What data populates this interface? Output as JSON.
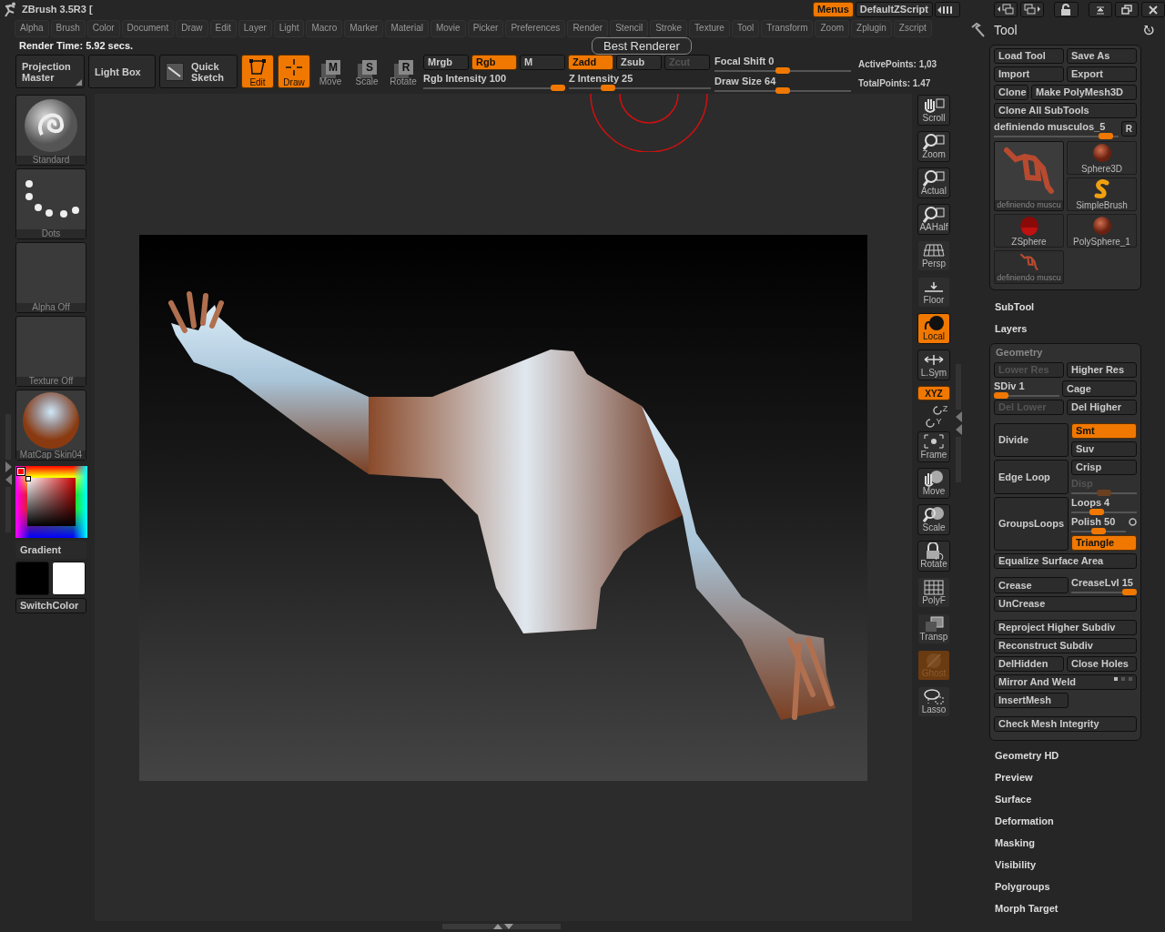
{
  "title": "ZBrush 3.5R3 [",
  "top_buttons": [
    {
      "label": "Menus",
      "selected": true
    },
    {
      "label": "DefaultZScript",
      "selected": false
    }
  ],
  "menus": [
    "Alpha",
    "Brush",
    "Color",
    "Document",
    "Draw",
    "Edit",
    "Layer",
    "Light",
    "Macro",
    "Marker",
    "Material",
    "Movie",
    "Picker",
    "Preferences",
    "Render",
    "Stencil",
    "Stroke",
    "Texture",
    "Tool",
    "Transform",
    "Zoom",
    "Zplugin",
    "Zscript"
  ],
  "render_time": "Render Time: 5.92 secs.",
  "tooltip": "Best Renderer",
  "toolbar": {
    "big_buttons": [
      {
        "kind": "corner",
        "label": "Projection Master"
      },
      {
        "kind": "plain",
        "label": "Light Box"
      },
      {
        "kind": "sketch",
        "label": "Quick Sketch"
      }
    ],
    "transform_modes": [
      {
        "kind": "edit",
        "label": "Edit",
        "selected": true
      },
      {
        "kind": "draw",
        "label": "Draw",
        "selected": true
      },
      {
        "kind": "letter",
        "key": "M",
        "label": "Move",
        "selected": false
      },
      {
        "kind": "letter",
        "key": "S",
        "label": "Scale",
        "selected": false
      },
      {
        "kind": "letter",
        "key": "R",
        "label": "Rotate",
        "selected": false
      }
    ],
    "color_modes": [
      {
        "label": "Mrgb",
        "selected": false
      },
      {
        "label": "Rgb",
        "selected": true
      },
      {
        "label": "M",
        "selected": false
      }
    ],
    "z_modes": [
      {
        "label": "Zadd",
        "selected": true
      },
      {
        "label": "Zsub",
        "selected": false
      },
      {
        "label": "Zcut",
        "selected": false
      }
    ],
    "sliders": [
      {
        "label": "Rgb Intensity 100",
        "level": 1
      },
      {
        "label": "Z Intensity 25",
        "level": 0.25
      },
      {
        "label": "Focal Shift 0",
        "level": 0.5
      },
      {
        "label": "Draw Size 64",
        "level": 0.5
      }
    ],
    "stats": [
      "ActivePoints: 1,03",
      "TotalPoints: 1.47"
    ]
  },
  "left_shelf": {
    "tiles": [
      {
        "kind": "brush",
        "label": "Standard"
      },
      {
        "kind": "dots",
        "label": "Dots"
      },
      {
        "kind": "empty",
        "label": "Alpha  Off"
      },
      {
        "kind": "empty",
        "label": "Texture  Off"
      },
      {
        "kind": "material",
        "label": "MatCap  Skin04"
      }
    ],
    "picker": {
      "color": "#ff0000"
    },
    "gradient": "Gradient",
    "swatches": [
      {
        "color": "#000000"
      },
      {
        "color": "#ffffff"
      }
    ],
    "switch": "SwitchColor"
  },
  "right_shelf": [
    {
      "kind": "scroll",
      "label": "Scroll",
      "on": false
    },
    {
      "kind": "zoom",
      "label": "Zoom",
      "on": false
    },
    {
      "kind": "actual",
      "label": "Actual",
      "on": false
    },
    {
      "kind": "aahalf",
      "label": "AAHalf",
      "on": false
    },
    {
      "kind": "persp",
      "label": "Persp",
      "on": false
    },
    {
      "kind": "floor",
      "label": "Floor",
      "on": false
    },
    {
      "kind": "local",
      "label": "Local",
      "on": true
    },
    {
      "kind": "lsym",
      "label": "L.Sym",
      "on": false
    },
    {
      "kind": "xyz",
      "label": "XYZ",
      "on": true
    },
    {
      "kind": "axis",
      "label": "Z",
      "on": false
    },
    {
      "kind": "axis",
      "label": "Y",
      "on": false
    },
    {
      "kind": "frame",
      "label": "Frame",
      "on": false
    },
    {
      "kind": "move",
      "label": "Move",
      "on": false
    },
    {
      "kind": "scale",
      "label": "Scale",
      "on": false
    },
    {
      "kind": "rotate",
      "label": "Rotate",
      "on": false
    },
    {
      "kind": "polyf",
      "label": "PolyF",
      "on": false
    },
    {
      "kind": "transp",
      "label": "Transp",
      "on": false
    },
    {
      "kind": "ghost",
      "label": "Ghost",
      "on": true
    },
    {
      "kind": "lasso",
      "label": "Lasso",
      "on": false
    }
  ],
  "tool_panel": {
    "title": "Tool",
    "button_rows": [
      [
        "Load Tool",
        "Save As"
      ],
      [
        "Import",
        "Export"
      ],
      [
        "Clone",
        "Make PolyMesh3D"
      ],
      [
        "Clone All SubTools"
      ]
    ],
    "current_tool": {
      "label": "definiendo musculos_5",
      "level": 0.95,
      "button": "R"
    },
    "tool_columns": [
      [
        {
          "kind": "mesh",
          "label": "definiendo  muscu",
          "selected": true
        },
        {
          "kind": "zsphere",
          "label": "ZSphere",
          "selected": false
        },
        {
          "kind": "mesh",
          "label": "definiendo  muscu",
          "selected": false
        }
      ],
      [
        {
          "kind": "sphere",
          "label": "Sphere3D",
          "selected": false
        },
        {
          "kind": "simplebrush",
          "label": "SimpleBrush",
          "selected": false
        },
        {
          "kind": "sphere",
          "label": "PolySphere_1",
          "selected": false
        }
      ]
    ],
    "sections_before": [
      "SubTool",
      "Layers"
    ],
    "geometry": {
      "title": "Geometry",
      "blocks": [
        [
          [
            {
              "kind": "button",
              "label": "Lower Res",
              "disabled": true
            },
            {
              "kind": "button",
              "label": "Higher Res",
              "disabled": false
            }
          ],
          [
            {
              "kind": "slider",
              "label": "SDiv 1",
              "level": 0,
              "disabled": false
            },
            {
              "kind": "button",
              "label": "Cage",
              "disabled": false
            }
          ],
          [
            {
              "kind": "button",
              "label": "Del Lower",
              "disabled": true
            },
            {
              "kind": "button",
              "label": "Del Higher",
              "disabled": false
            }
          ]
        ],
        [
          [
            {
              "kind": "group",
              "label": "Divide",
              "side": [
                {
                  "kind": "toggle",
                  "label": "Smt",
                  "on": true,
                  "disabled": false
                },
                {
                  "kind": "toggle",
                  "label": "Suv",
                  "on": false,
                  "disabled": false
                }
              ]
            }
          ],
          [
            {
              "kind": "group",
              "label": "Edge Loop",
              "side": [
                {
                  "kind": "toggle",
                  "label": "Crisp",
                  "on": false,
                  "disabled": false
                },
                {
                  "kind": "slider",
                  "label": "Disp",
                  "level": 0.5,
                  "disabled": true
                }
              ]
            }
          ],
          [
            {
              "kind": "group",
              "label": "GroupsLoops",
              "side": [
                {
                  "kind": "slider",
                  "label": "Loops 4",
                  "level": 0.35,
                  "disabled": false
                },
                {
                  "kind": "slider",
                  "label": "Polish 50",
                  "level": 0.5,
                  "disabled": false,
                  "dot": true
                },
                {
                  "kind": "toggle",
                  "label": "Triangle",
                  "on": true,
                  "disabled": false
                }
              ]
            }
          ],
          [
            {
              "kind": "button",
              "label": "Equalize Surface Area",
              "disabled": false
            }
          ]
        ],
        [
          [
            {
              "kind": "button",
              "label": "Crease",
              "disabled": false
            },
            {
              "kind": "slider",
              "label": "CreaseLvl 15",
              "level": 1,
              "disabled": false
            }
          ],
          [
            {
              "kind": "button",
              "label": "UnCrease",
              "disabled": false
            }
          ]
        ],
        [
          [
            {
              "kind": "button",
              "label": "Reproject Higher Subdiv",
              "disabled": false
            }
          ],
          [
            {
              "kind": "button",
              "label": "Reconstruct Subdiv",
              "disabled": false
            }
          ],
          [
            {
              "kind": "button",
              "label": "DelHidden",
              "disabled": false
            },
            {
              "kind": "button",
              "label": "Close Holes",
              "disabled": false
            }
          ],
          [
            {
              "kind": "button",
              "label": "Mirror And Weld",
              "disabled": false,
              "axes": true
            }
          ],
          [
            {
              "kind": "half",
              "label": "InsertMesh",
              "disabled": false
            }
          ]
        ],
        [
          [
            {
              "kind": "button",
              "label": "Check Mesh Integrity",
              "disabled": false
            }
          ]
        ]
      ]
    },
    "sections_after": [
      "Geometry HD",
      "Preview",
      "Surface",
      "Deformation",
      "Masking",
      "Visibility",
      "Polygroups",
      "Morph Target"
    ]
  }
}
